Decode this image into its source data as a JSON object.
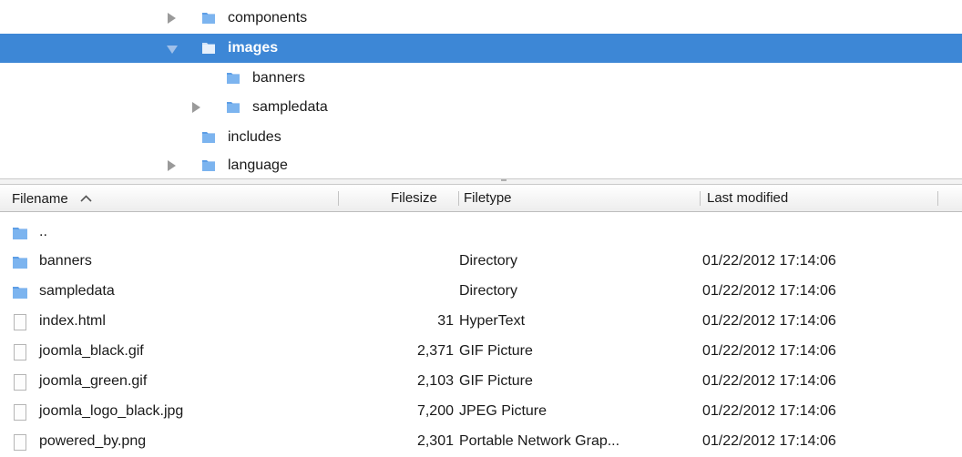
{
  "tree": {
    "items": [
      {
        "label": "components",
        "expander": "collapsed"
      },
      {
        "label": "images",
        "expander": "expanded",
        "selected": true
      },
      {
        "label": "banners",
        "expander": "none"
      },
      {
        "label": "sampledata",
        "expander": "collapsed"
      },
      {
        "label": "includes",
        "expander": "none"
      },
      {
        "label": "language",
        "expander": "collapsed"
      }
    ]
  },
  "list": {
    "columns": {
      "filename": "Filename",
      "filesize": "Filesize",
      "filetype": "Filetype",
      "last_modified": "Last modified"
    },
    "sort_icon": "chevron-up-icon",
    "rows": [
      {
        "name": "..",
        "size": "",
        "type": "",
        "modified": "",
        "icon": "folder-icon"
      },
      {
        "name": "banners",
        "size": "",
        "type": "Directory",
        "modified": "01/22/2012 17:14:06",
        "icon": "folder-icon"
      },
      {
        "name": "sampledata",
        "size": "",
        "type": "Directory",
        "modified": "01/22/2012 17:14:06",
        "icon": "folder-icon"
      },
      {
        "name": "index.html",
        "size": "31",
        "type": "HyperText",
        "modified": "01/22/2012 17:14:06",
        "icon": "file-icon"
      },
      {
        "name": "joomla_black.gif",
        "size": "2,371",
        "type": "GIF Picture",
        "modified": "01/22/2012 17:14:06",
        "icon": "file-icon"
      },
      {
        "name": "joomla_green.gif",
        "size": "2,103",
        "type": "GIF Picture",
        "modified": "01/22/2012 17:14:06",
        "icon": "file-icon"
      },
      {
        "name": "joomla_logo_black.jpg",
        "size": "7,200",
        "type": "JPEG Picture",
        "modified": "01/22/2012 17:14:06",
        "icon": "file-icon"
      },
      {
        "name": "powered_by.png",
        "size": "2,301",
        "type": "Portable Network Grap...",
        "modified": "01/22/2012 17:14:06",
        "icon": "file-icon"
      }
    ]
  },
  "colors": {
    "selection": "#3d87d6",
    "folder": "#5d9ee6"
  }
}
